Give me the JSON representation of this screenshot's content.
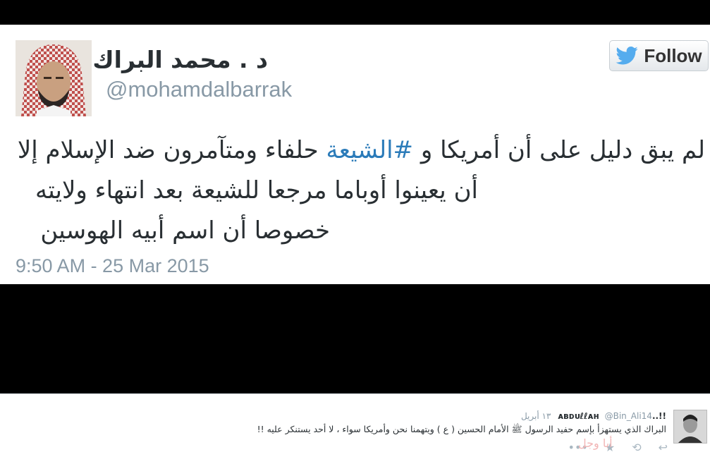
{
  "tweet": {
    "display_name": "د . محمد البراك",
    "handle": "@mohamdalbarrak",
    "follow_label": "Follow",
    "text": {
      "line1_before": "لم يبق دليل على أن أمريكا و ",
      "hashtag": "#الشيعة",
      "line1_after": " حلفاء ومتآمرون ضد الإسلام إلا",
      "line2": "أن يعينوا أوباما مرجعا للشيعة بعد انتهاء ولايته",
      "line3": "خصوصا أن اسم أبيه الهوسين"
    },
    "timestamp": "9:50 AM - 25 Mar 2015"
  },
  "reply": {
    "name": "!!..ᴀʙᴅᴜℓℓᴀн",
    "handle": "@Bin_Ali14",
    "time": "١٣ أبريل",
    "text": "البراك الذي يستهزأ بإسم حفيد الرسول ﷺ الأمام الحسين ( ع ) ويتهمنا نحن وأمريكا سواء ، لا أحد يستنكر عليه !!",
    "watermark": "أبا وجل"
  },
  "colors": {
    "hashtag": "#2b7bb9",
    "text": "#292f33",
    "muted": "#8899a6",
    "twitter_blue": "#55acee"
  }
}
